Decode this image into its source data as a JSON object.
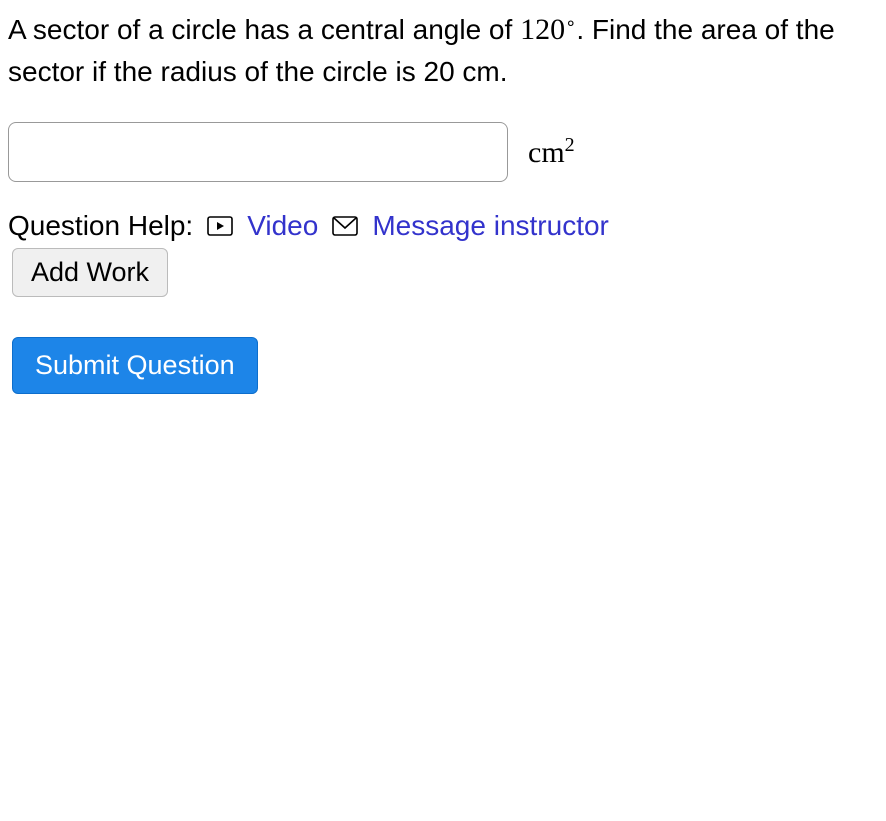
{
  "question": {
    "text_part1": "A sector of a circle has a central angle of ",
    "angle_value": "120",
    "degree_symbol": "∘",
    "text_part2": ". Find the area of the sector if the radius of the circle is 20 cm."
  },
  "answer": {
    "input_value": "",
    "unit_base": "cm",
    "unit_exp": "2"
  },
  "help": {
    "label": "Question Help:",
    "video_label": "Video",
    "message_label": "Message instructor"
  },
  "buttons": {
    "add_work": "Add Work",
    "submit": "Submit Question"
  }
}
